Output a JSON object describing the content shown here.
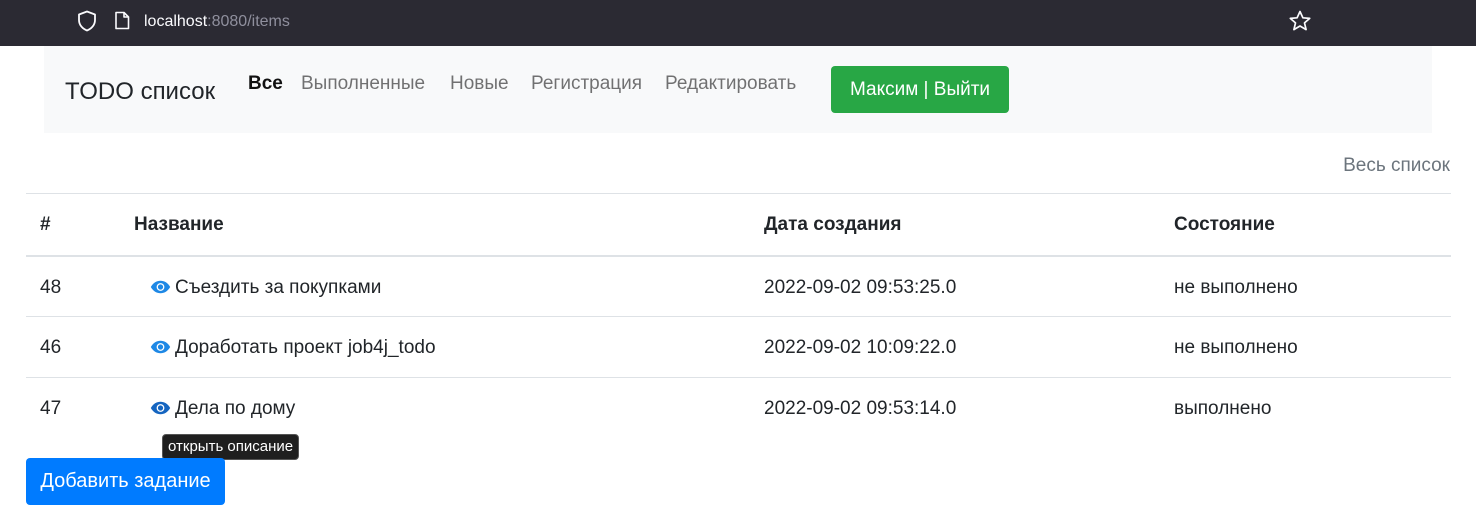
{
  "browser": {
    "url_host": "localhost",
    "url_rest": ":8080/items"
  },
  "navbar": {
    "brand": "TODO список",
    "links": [
      {
        "label": "Все",
        "active": true
      },
      {
        "label": "Выполненные",
        "active": false
      },
      {
        "label": "Новые",
        "active": false
      },
      {
        "label": "Регистрация",
        "active": false
      },
      {
        "label": "Редактировать",
        "active": false
      }
    ],
    "user_button": "Максим | Выйти"
  },
  "all_list_link": "Весь список",
  "table": {
    "headers": [
      "#",
      "Название",
      "Дата создания",
      "Состояние"
    ],
    "rows": [
      {
        "id": "48",
        "name": "Съездить за покупками",
        "created": "2022-09-02 09:53:25.0",
        "state": "не выполнено"
      },
      {
        "id": "46",
        "name": "Доработать проект job4j_todo",
        "created": "2022-09-02 10:09:22.0",
        "state": "не выполнено"
      },
      {
        "id": "47",
        "name": "Дела по дому",
        "created": "2022-09-02 09:53:14.0",
        "state": "выполнено"
      }
    ]
  },
  "tooltip": "открыть описание",
  "add_button": "Добавить задание",
  "colors": {
    "success": "#28a745",
    "primary": "#007bff",
    "eye_icon": "#1e88e5"
  },
  "icons": [
    "shield-icon",
    "page-icon",
    "star-icon",
    "eye-icon"
  ]
}
